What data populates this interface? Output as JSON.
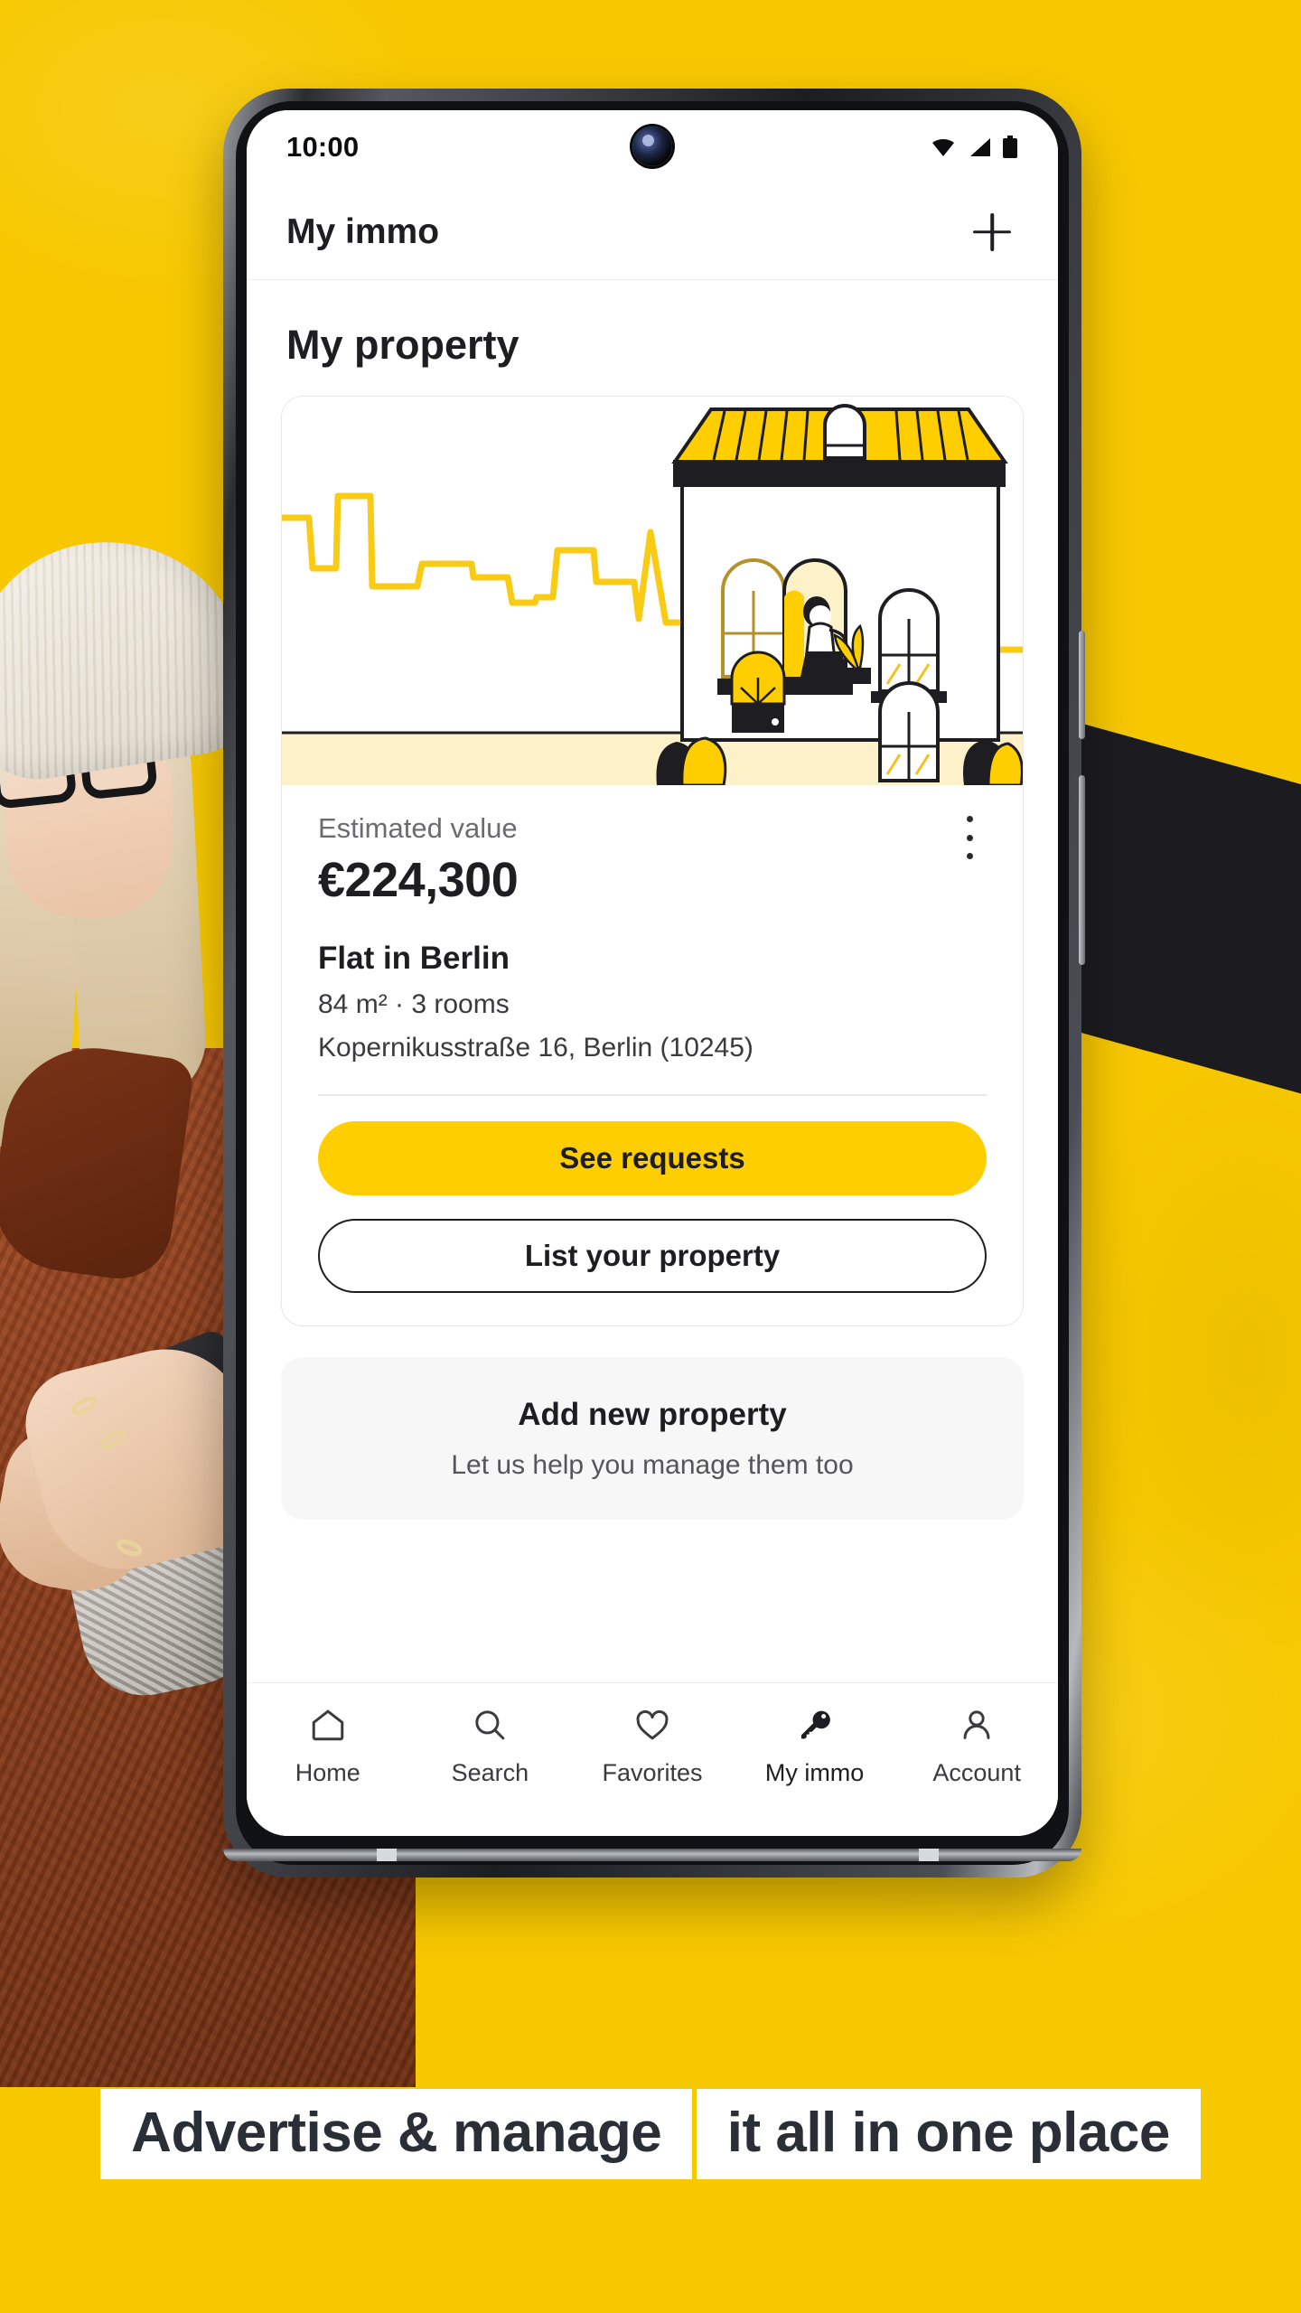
{
  "theme": {
    "brand_yellow": "#F7C800",
    "button_yellow": "#FFCE00",
    "ink": "#1D1D22",
    "stripe_black": "#1C1C20",
    "card_grey": "#F7F7F7"
  },
  "statusbar": {
    "time": "10:00",
    "icons": [
      "wifi-icon",
      "cellular-signal-icon",
      "battery-icon"
    ]
  },
  "appbar": {
    "title": "My immo",
    "add_icon": "plus-icon"
  },
  "main": {
    "page_title": "My property",
    "property_card": {
      "illustration_name": "house-with-person-illustration",
      "estimated_value_label": "Estimated value",
      "estimated_value": "€224,300",
      "title": "Flat in Berlin",
      "specs": "84 m² · 3 rooms",
      "address": "Kopernikusstraße 16, Berlin (10245)",
      "menu_icon": "kebab-menu-icon",
      "primary_button": "See requests",
      "secondary_button": "List your property"
    },
    "add_card": {
      "title": "Add new property",
      "subtitle": "Let us help you manage them too"
    }
  },
  "bottomnav": {
    "items": [
      {
        "label": "Home",
        "icon": "home-icon",
        "active": false
      },
      {
        "label": "Search",
        "icon": "search-icon",
        "active": false
      },
      {
        "label": "Favorites",
        "icon": "heart-icon",
        "active": false
      },
      {
        "label": "My immo",
        "icon": "key-icon",
        "active": true
      },
      {
        "label": "Account",
        "icon": "person-icon",
        "active": false
      }
    ]
  },
  "promo": {
    "headline_line1": "Advertise & manage",
    "headline_line2": "it all in one place"
  }
}
